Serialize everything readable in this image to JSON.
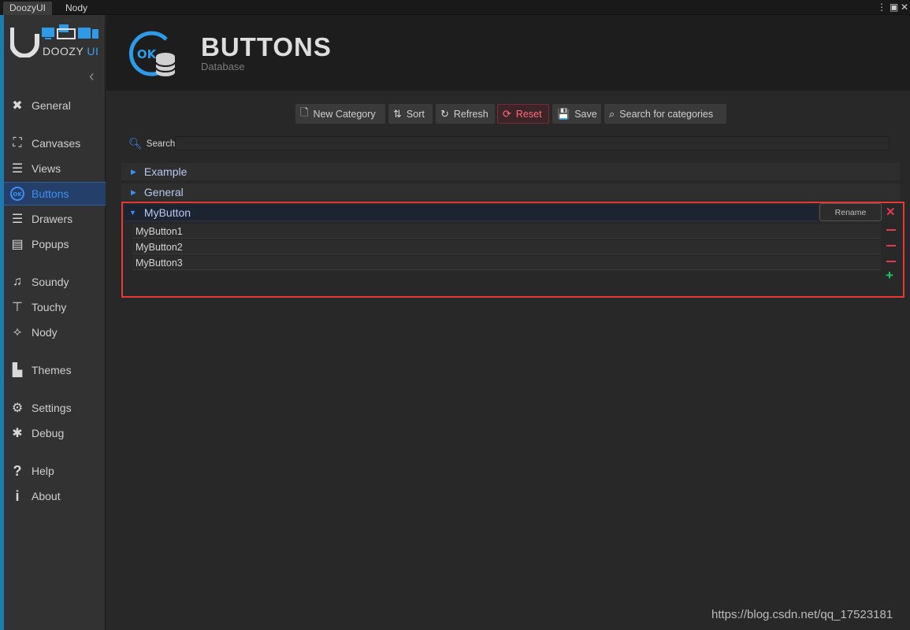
{
  "window_tabs": [
    "DoozyUI",
    "Nody"
  ],
  "brand": {
    "logo_text": "DOOZY",
    "logo_accent": "UI"
  },
  "sidebar": {
    "items": [
      {
        "label": "General",
        "icon": "general-icon"
      },
      {
        "label": "Canvases",
        "icon": "canvas-icon"
      },
      {
        "label": "Views",
        "icon": "views-icon"
      },
      {
        "label": "Buttons",
        "icon": "ok-icon",
        "active": true
      },
      {
        "label": "Drawers",
        "icon": "drawers-icon"
      },
      {
        "label": "Popups",
        "icon": "popups-icon"
      },
      {
        "label": "Soundy",
        "icon": "soundy-icon"
      },
      {
        "label": "Touchy",
        "icon": "touchy-icon"
      },
      {
        "label": "Nody",
        "icon": "nody-icon"
      },
      {
        "label": "Themes",
        "icon": "themes-icon"
      },
      {
        "label": "Settings",
        "icon": "gear-icon"
      },
      {
        "label": "Debug",
        "icon": "bug-icon"
      },
      {
        "label": "Help",
        "icon": "help-icon"
      },
      {
        "label": "About",
        "icon": "info-icon"
      }
    ]
  },
  "header": {
    "title": "BUTTONS",
    "subtitle": "Database"
  },
  "toolbar": {
    "new_category": "New Category",
    "sort": "Sort",
    "refresh": "Refresh",
    "reset": "Reset",
    "save": "Save",
    "search_categories": "Search for categories"
  },
  "search": {
    "label": "Search",
    "value": ""
  },
  "categories": [
    {
      "name": "Example",
      "expanded": false
    },
    {
      "name": "General",
      "expanded": false
    },
    {
      "name": "MyButton",
      "expanded": true
    }
  ],
  "open_category": {
    "name": "MyButton",
    "rename_label": "Rename",
    "items": [
      "MyButton1",
      "MyButton2",
      "MyButton3"
    ]
  },
  "watermark": "https://blog.csdn.net/qq_17523181",
  "colors": {
    "accent": "#3d8ef0",
    "danger": "#e53950",
    "add": "#21c45a",
    "selection_frame": "#e53935"
  }
}
